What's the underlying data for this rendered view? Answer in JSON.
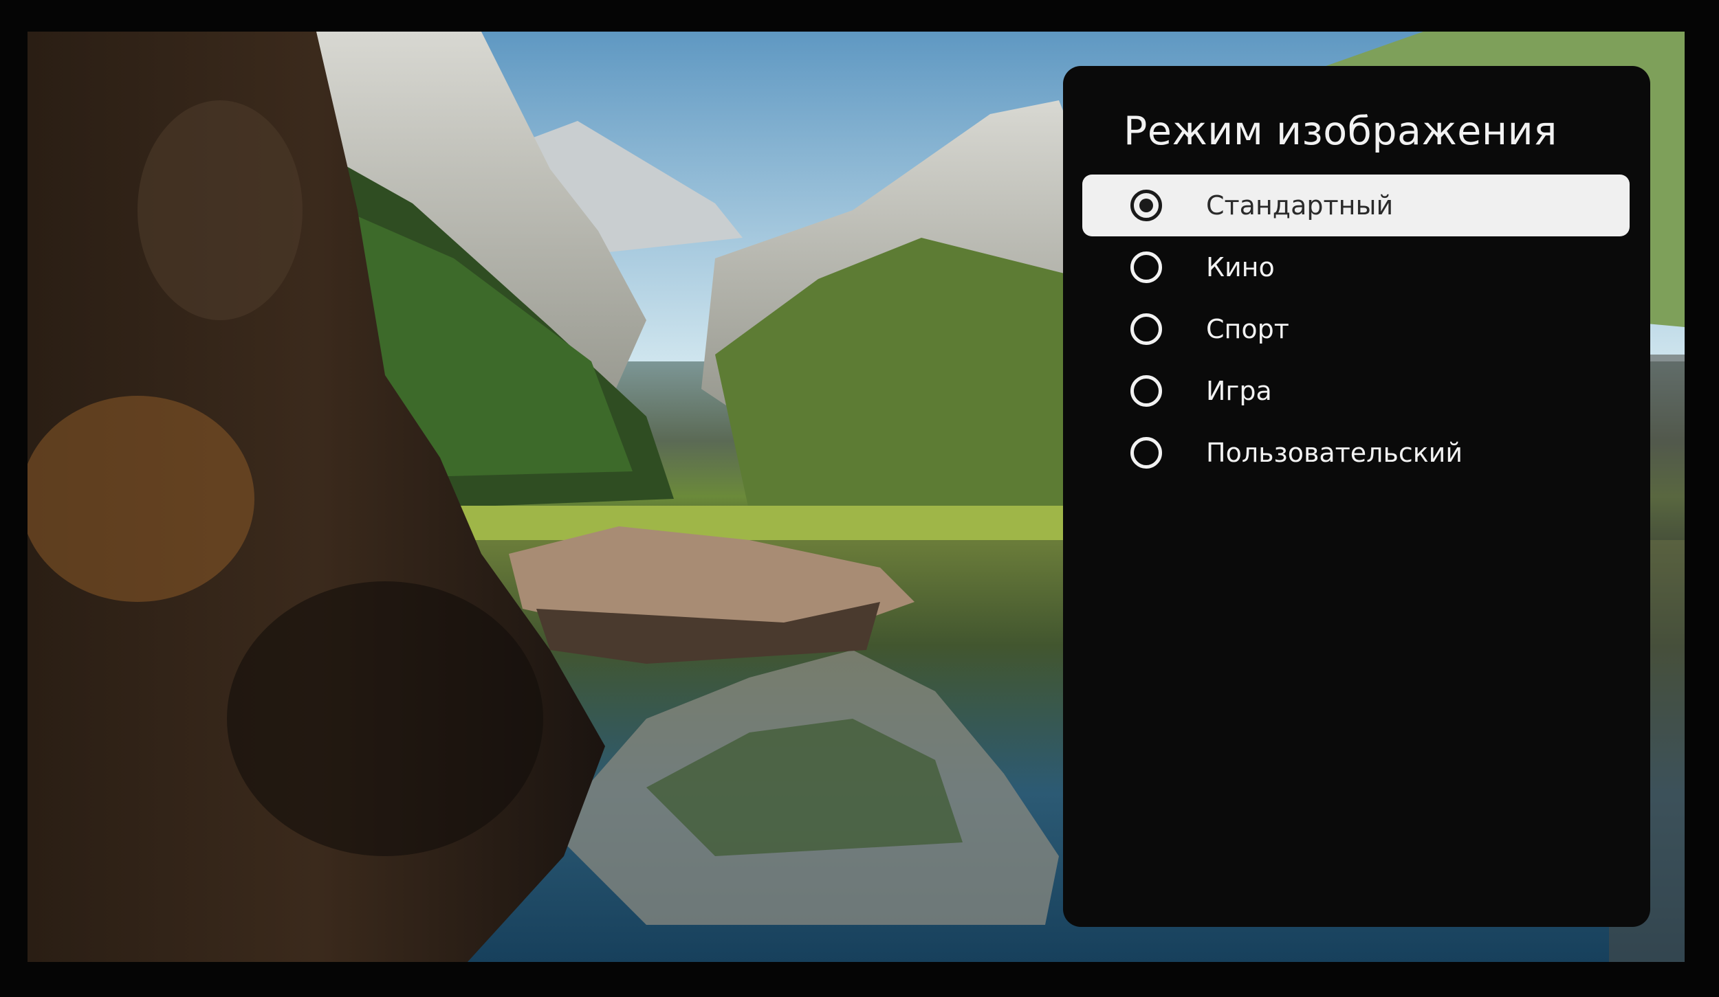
{
  "menu": {
    "title": "Режим изображения",
    "items": [
      {
        "label": "Стандартный",
        "selected": true
      },
      {
        "label": "Кино",
        "selected": false
      },
      {
        "label": "Спорт",
        "selected": false
      },
      {
        "label": "Игра",
        "selected": false
      },
      {
        "label": "Пользовательский",
        "selected": false
      }
    ]
  }
}
